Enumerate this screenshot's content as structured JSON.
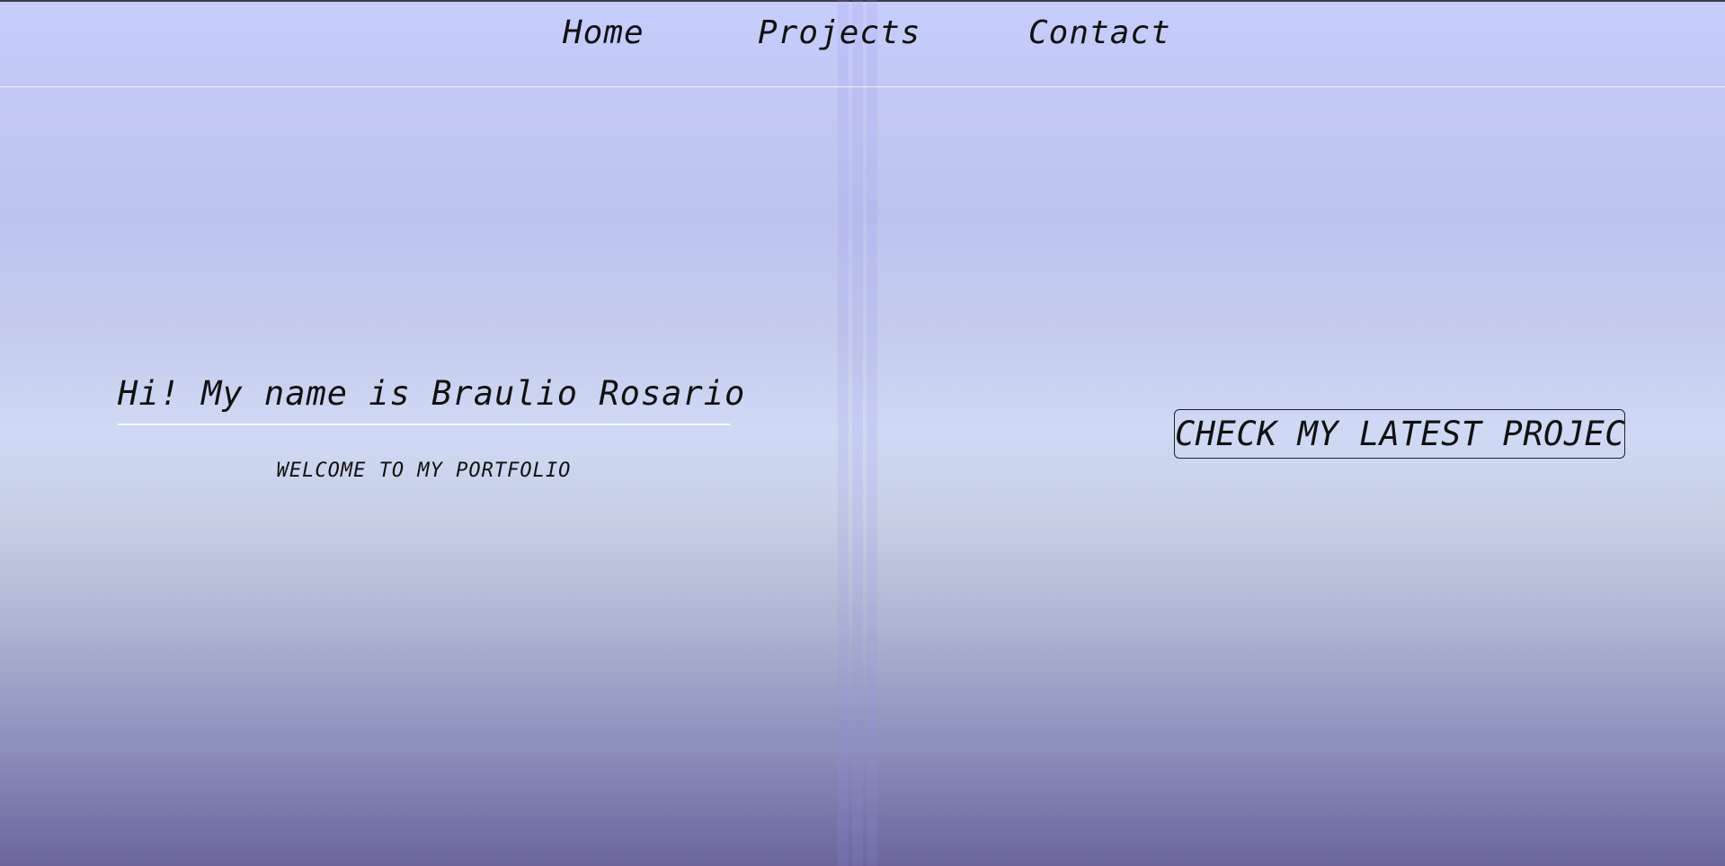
{
  "nav": {
    "items": [
      {
        "label": "Home"
      },
      {
        "label": "Projects"
      },
      {
        "label": "Contact"
      }
    ]
  },
  "hero": {
    "title": "Hi! My name is Braulio Rosario",
    "subtitle": "WELCOME TO MY PORTFOLIO",
    "cta_label": "CHECK MY LATEST PROJECT"
  },
  "colors": {
    "gradient_top": "#c7cdfd",
    "gradient_middle": "#d0d9f4",
    "gradient_bottom": "#6a669d",
    "text": "#111111",
    "divider": "#ffffff"
  }
}
